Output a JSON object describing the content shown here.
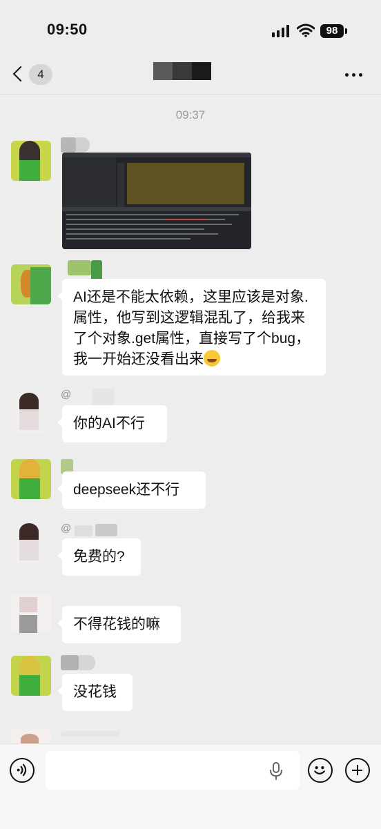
{
  "status_bar": {
    "time": "09:50",
    "battery": "98",
    "icons": [
      "signal-icon",
      "wifi-icon",
      "battery-icon"
    ]
  },
  "nav": {
    "unread_count": "4",
    "title": "",
    "icons": [
      "chevron-left-icon",
      "more-icon"
    ]
  },
  "chat": {
    "timestamp": "09:37",
    "messages": [
      {
        "type": "image",
        "content": "code screenshot"
      },
      {
        "type": "text",
        "text": "AI还是不能太依赖，这里应该是对象.属性，他写到这逻辑混乱了，给我来了个对象.get属性，直接写了个bug，我一开始还没看出来",
        "emoji": "rofl"
      },
      {
        "type": "text",
        "sender_prefix": "@",
        "text": "你的AI不行"
      },
      {
        "type": "text",
        "text": "deepseek还不行"
      },
      {
        "type": "text",
        "sender_prefix": "@",
        "text": "免费的?"
      },
      {
        "type": "text",
        "text": "不得花钱的嘛"
      },
      {
        "type": "text",
        "text": "没花钱"
      }
    ]
  },
  "input_bar": {
    "placeholder": "",
    "icons": [
      "voice-icon",
      "mic-icon",
      "emoji-icon",
      "plus-icon"
    ]
  },
  "colors": {
    "background": "#ededed",
    "bubble": "#ffffff",
    "timestamp": "#9a9a9a"
  }
}
